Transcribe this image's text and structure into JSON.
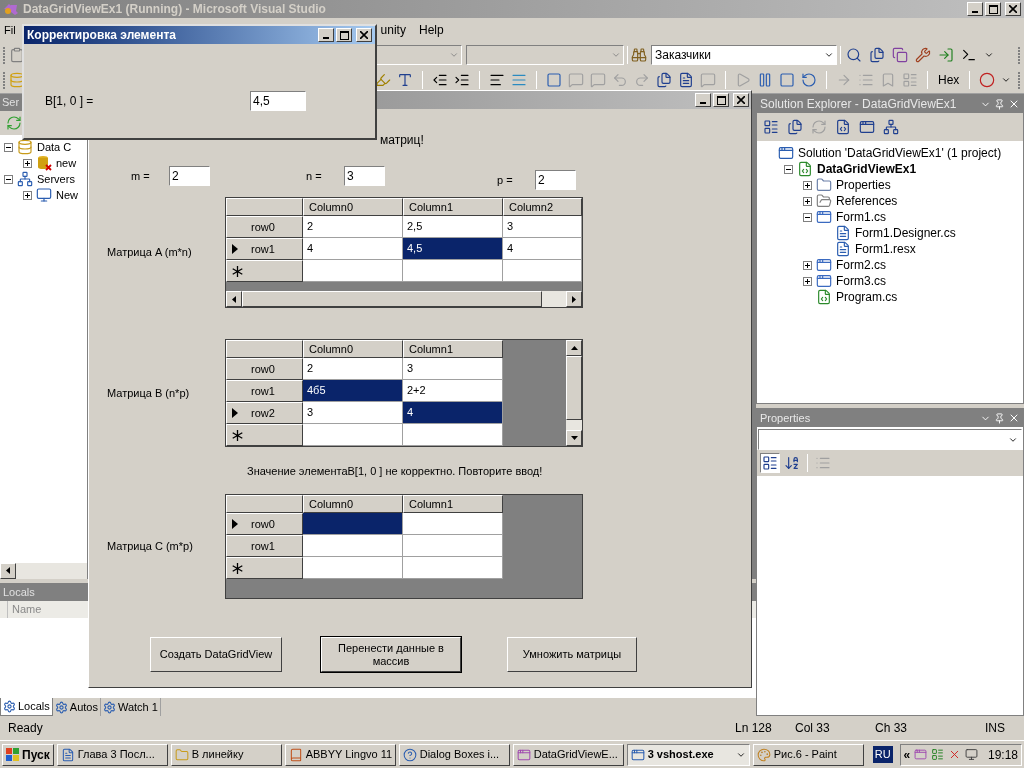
{
  "vs_window": {
    "title": "DataGridViewEx1 (Running) - Microsoft Visual Studio"
  },
  "menu": [
    "Fil",
    "unity",
    "Help"
  ],
  "toolbar": {
    "combo_value": "Заказчики",
    "hex": "Hex"
  },
  "server_explorer": {
    "title": "Ser",
    "tree": [
      {
        "label": "Data C",
        "expanded": true,
        "kind": "connections",
        "children": [
          {
            "label": "new",
            "expanded": false,
            "kind": "broken-connection"
          }
        ]
      },
      {
        "label": "Servers",
        "expanded": true,
        "kind": "servers",
        "children": [
          {
            "label": "New",
            "expanded": false,
            "kind": "computer"
          }
        ]
      }
    ]
  },
  "locals": {
    "title": "Locals",
    "columns": [
      "Name"
    ]
  },
  "bottom_tabs": [
    {
      "label": "Locals",
      "selected": true
    },
    {
      "label": "Autos",
      "selected": false
    },
    {
      "label": "Watch 1",
      "selected": false
    }
  ],
  "solution_explorer": {
    "title": "Solution Explorer - DataGridViewEx1",
    "tree": [
      {
        "label": "Solution 'DataGridViewEx1' (1 project)",
        "kind": "solution",
        "children": [
          {
            "label": "DataGridViewEx1",
            "expanded": true,
            "kind": "project",
            "children": [
              {
                "label": "Properties",
                "expanded": false,
                "kind": "folder"
              },
              {
                "label": "References",
                "expanded": false,
                "kind": "references"
              },
              {
                "label": "Form1.cs",
                "expanded": true,
                "kind": "form",
                "children": [
                  {
                    "label": "Form1.Designer.cs",
                    "kind": "file"
                  },
                  {
                    "label": "Form1.resx",
                    "kind": "file"
                  }
                ]
              },
              {
                "label": "Form2.cs",
                "expanded": false,
                "kind": "form"
              },
              {
                "label": "Form3.cs",
                "expanded": false,
                "kind": "form"
              },
              {
                "label": "Program.cs",
                "kind": "code"
              }
            ]
          }
        ]
      }
    ]
  },
  "properties": {
    "title": "Properties"
  },
  "status_bar": [
    "Ready",
    "Ln 128",
    "Col 33",
    "Ch 33",
    "INS"
  ],
  "taskbar": {
    "start": "Пуск",
    "items": [
      {
        "label": "Глава 3 Посл...",
        "selected": false
      },
      {
        "label": "В линейку",
        "selected": false
      },
      {
        "label": "ABBYY Lingvo 11",
        "selected": false
      },
      {
        "label": "Dialog Boxes i...",
        "selected": false
      },
      {
        "label": "DataGridViewE...",
        "selected": false
      },
      {
        "label": "3 vshost.exe",
        "selected": true,
        "grouped": true
      },
      {
        "label": "Рис.6 - Paint",
        "selected": false
      }
    ],
    "language": "RU",
    "tray_chevron": "«",
    "clock": "19:18"
  },
  "form": {
    "heading": "матриц!",
    "params": [
      {
        "label": "m =",
        "value": "2"
      },
      {
        "label": "n =",
        "value": "3"
      },
      {
        "label": "p =",
        "value": "2"
      }
    ],
    "grids": [
      {
        "label": "Матрица A (m*n)",
        "kind": "horizontal-scroll",
        "columns": [
          "Column0",
          "Column1",
          "Column2"
        ],
        "rows": [
          {
            "kind": "data",
            "header": "row0",
            "current": false,
            "cells": [
              {
                "text": "2",
                "selected": false
              },
              {
                "text": "2,5",
                "selected": false
              },
              {
                "text": "3",
                "selected": false
              }
            ]
          },
          {
            "kind": "data",
            "header": "row1",
            "current": true,
            "cells": [
              {
                "text": "4",
                "selected": false
              },
              {
                "text": "4,5",
                "selected": true
              },
              {
                "text": "4",
                "selected": false
              }
            ]
          },
          {
            "kind": "new",
            "current": false,
            "cells": [
              {
                "selected": false
              },
              {
                "selected": false
              },
              {
                "selected": false
              }
            ]
          }
        ]
      },
      {
        "label": "Матрица B (n*p)",
        "kind": "vertical-scroll",
        "columns": [
          "Column0",
          "Column1"
        ],
        "rows": [
          {
            "kind": "data",
            "header": "row0",
            "current": false,
            "cells": [
              {
                "text": "2",
                "selected": false
              },
              {
                "text": "3",
                "selected": false
              }
            ]
          },
          {
            "kind": "data",
            "header": "row1",
            "current": false,
            "cells": [
              {
                "text": "4б5",
                "selected": true
              },
              {
                "text": "2+2",
                "selected": false
              }
            ]
          },
          {
            "kind": "data",
            "header": "row2",
            "current": true,
            "cells": [
              {
                "text": "3",
                "selected": false
              },
              {
                "text": "4",
                "selected": true
              }
            ]
          },
          {
            "kind": "new",
            "current": false,
            "cells": [
              {
                "selected": false
              },
              {
                "selected": false
              }
            ]
          }
        ]
      },
      {
        "label": "Матрица C (m*p)",
        "kind": "plain",
        "columns": [
          "Column0",
          "Column1"
        ],
        "rows": [
          {
            "kind": "data",
            "header": "row0",
            "current": true,
            "cells": [
              {
                "selected": true
              },
              {
                "selected": false
              }
            ]
          },
          {
            "kind": "data",
            "header": "row1",
            "current": false,
            "cells": [
              {
                "selected": false
              },
              {
                "selected": false
              }
            ]
          },
          {
            "kind": "new",
            "current": false,
            "cells": [
              {
                "selected": false
              },
              {
                "selected": false
              }
            ]
          }
        ]
      }
    ],
    "message": "Значение элементаB[1, 0 ] не корректно. Повторите ввод!",
    "buttons": [
      {
        "label": "Создать DataGridView",
        "focused": false
      },
      {
        "label": "Перенести данные в массив",
        "focused": true
      },
      {
        "label": "Умножить матрицы",
        "focused": false
      }
    ]
  },
  "dialog": {
    "title": "Корректировка элемента",
    "label": "B[1, 0 ] =",
    "value": "4,5"
  }
}
